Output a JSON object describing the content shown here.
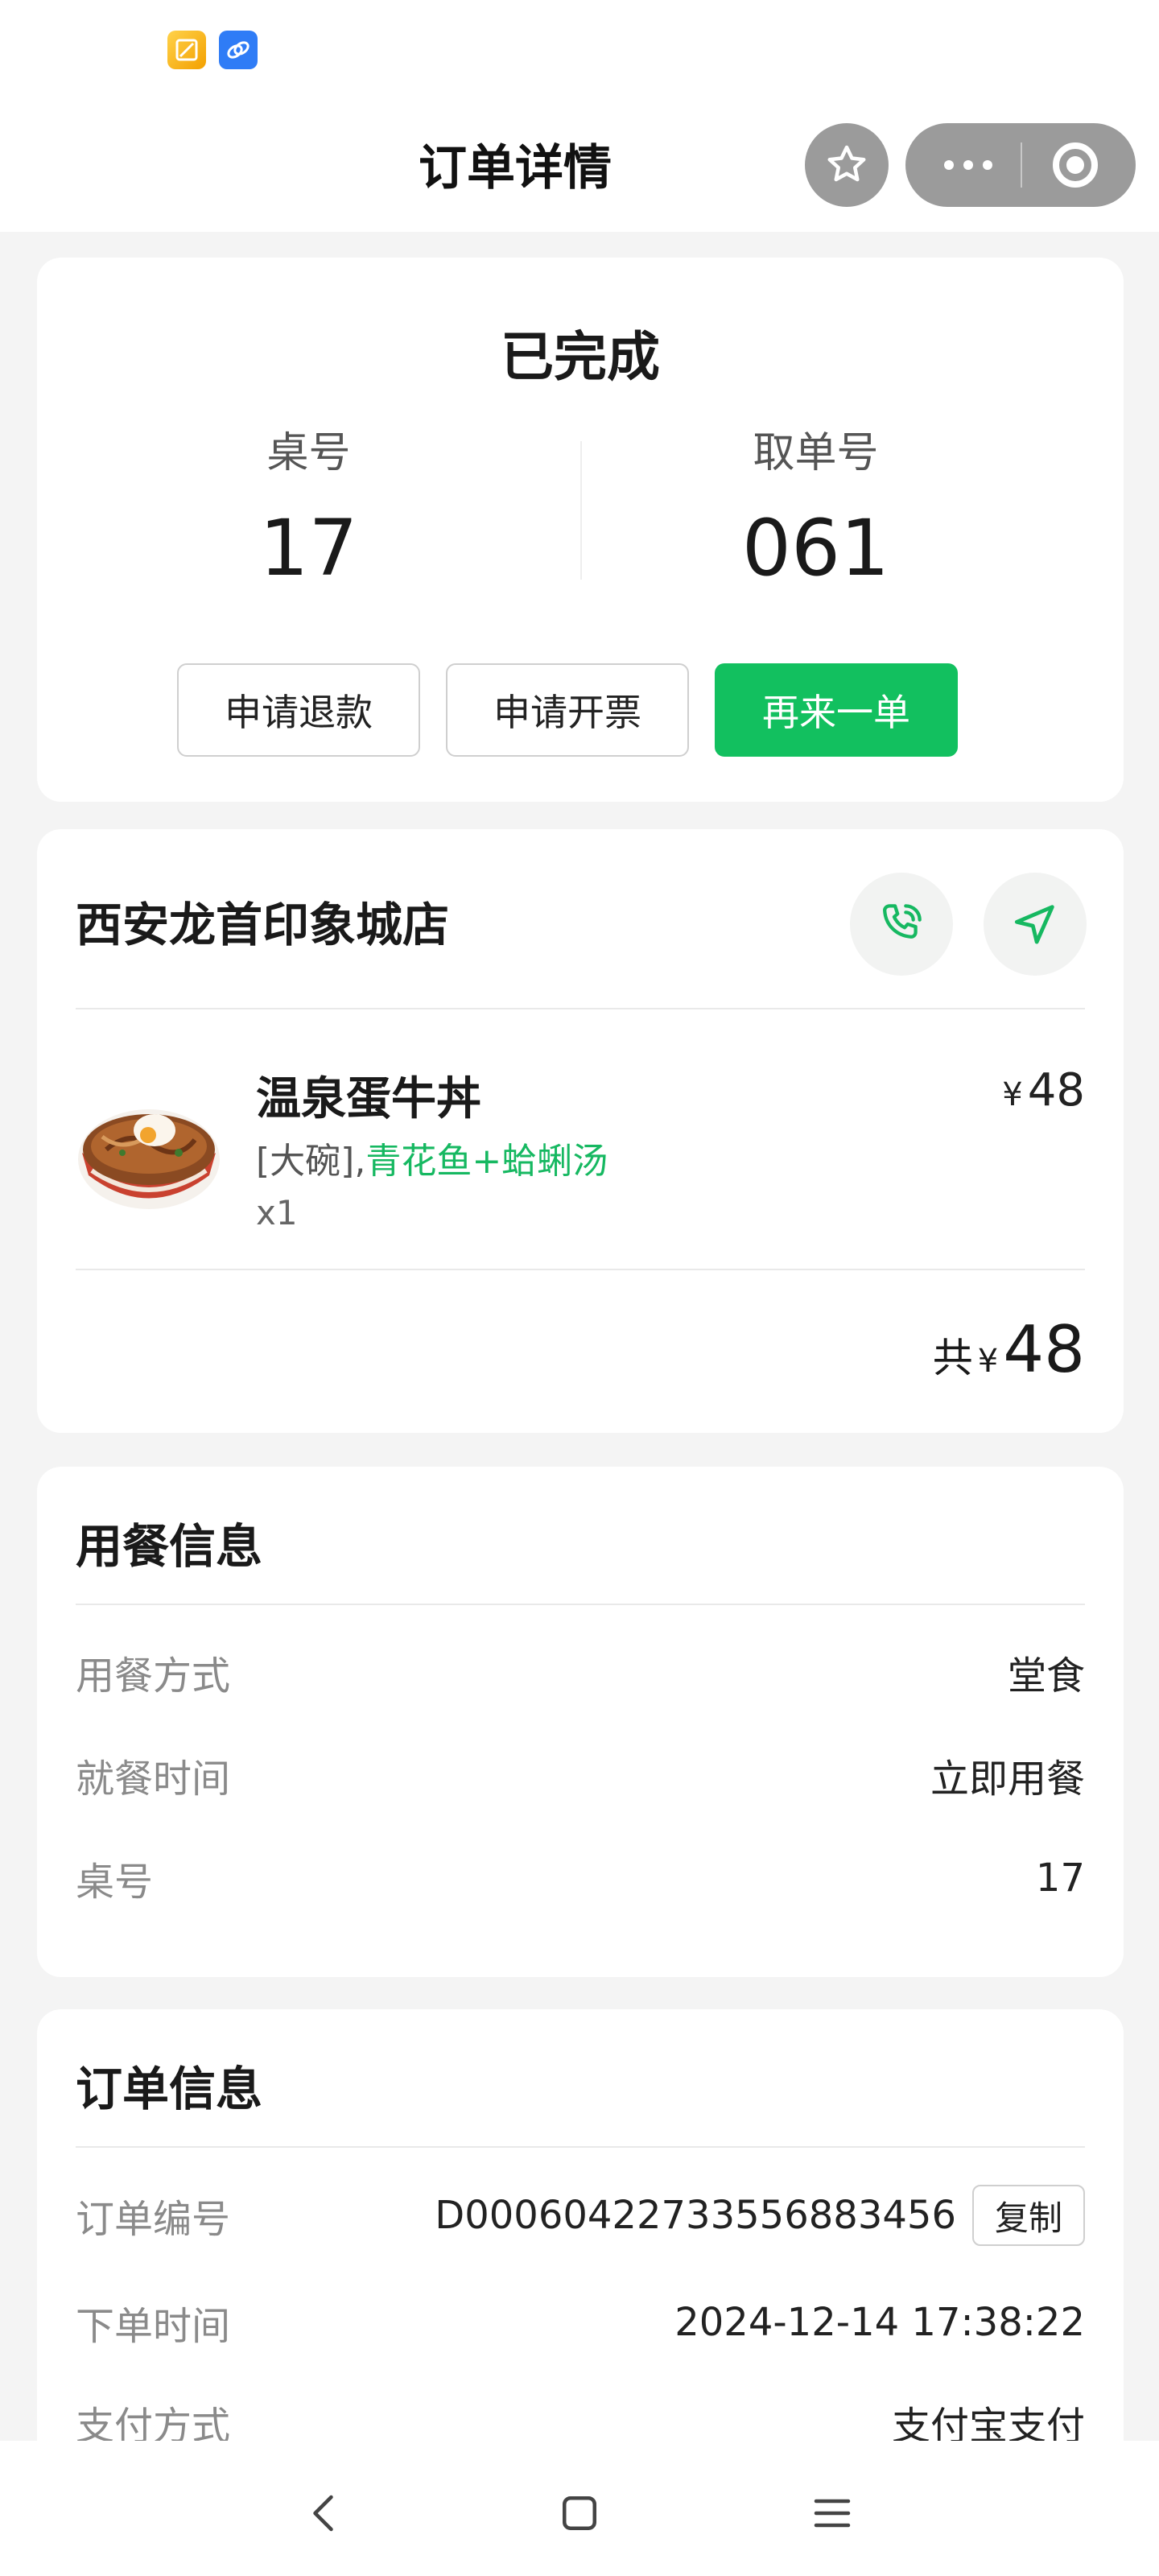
{
  "header": {
    "title": "订单详情"
  },
  "order_status": {
    "status": "已完成",
    "table_label": "桌号",
    "table_value": "17",
    "pickup_label": "取单号",
    "pickup_value": "061",
    "buttons": {
      "refund": "申请退款",
      "invoice": "申请开票",
      "reorder": "再来一单"
    }
  },
  "store": {
    "name": "西安龙首印象城店",
    "item": {
      "name": "温泉蛋牛丼",
      "spec_bracket": "[大碗],",
      "spec_addon": "青花鱼+蛤蜊汤",
      "qty": "x1",
      "currency": "¥",
      "price": "48"
    },
    "total_prefix": "共",
    "total_currency": "¥",
    "total": "48"
  },
  "dining_info": {
    "title": "用餐信息",
    "rows": [
      {
        "label": "用餐方式",
        "value": "堂食"
      },
      {
        "label": "就餐时间",
        "value": "立即用餐"
      },
      {
        "label": "桌号",
        "value": "17"
      }
    ]
  },
  "order_info": {
    "title": "订单信息",
    "rows": [
      {
        "label": "订单编号",
        "value": "D0006042273355688345​6"
      },
      {
        "label": "下单时间",
        "value": "2024-12-14 17:38:22"
      },
      {
        "label": "支付方式",
        "value": "支付宝支付"
      }
    ],
    "copy_label": "复制"
  },
  "colors": {
    "accent": "#12c05f",
    "background": "#f4f4f4",
    "capsule": "#9b9b9b"
  }
}
